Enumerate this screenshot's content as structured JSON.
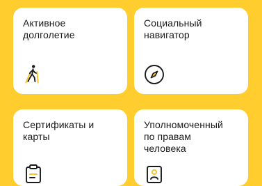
{
  "tiles": [
    {
      "label": "Активное\nдолголетие",
      "icon": "nordic-walking-icon"
    },
    {
      "label": "Социальный\nнавигатор",
      "icon": "compass-icon"
    },
    {
      "label": "Сертификаты и\nкарты",
      "icon": "clipboard-icon"
    },
    {
      "label": "Уполномоченный\nпо правам\nчеловека",
      "icon": "id-badge-icon"
    }
  ],
  "colors": {
    "background": "#FFCD2E",
    "card": "#FFFFFF",
    "text": "#1A1A1A",
    "accent": "#F6C32B"
  }
}
